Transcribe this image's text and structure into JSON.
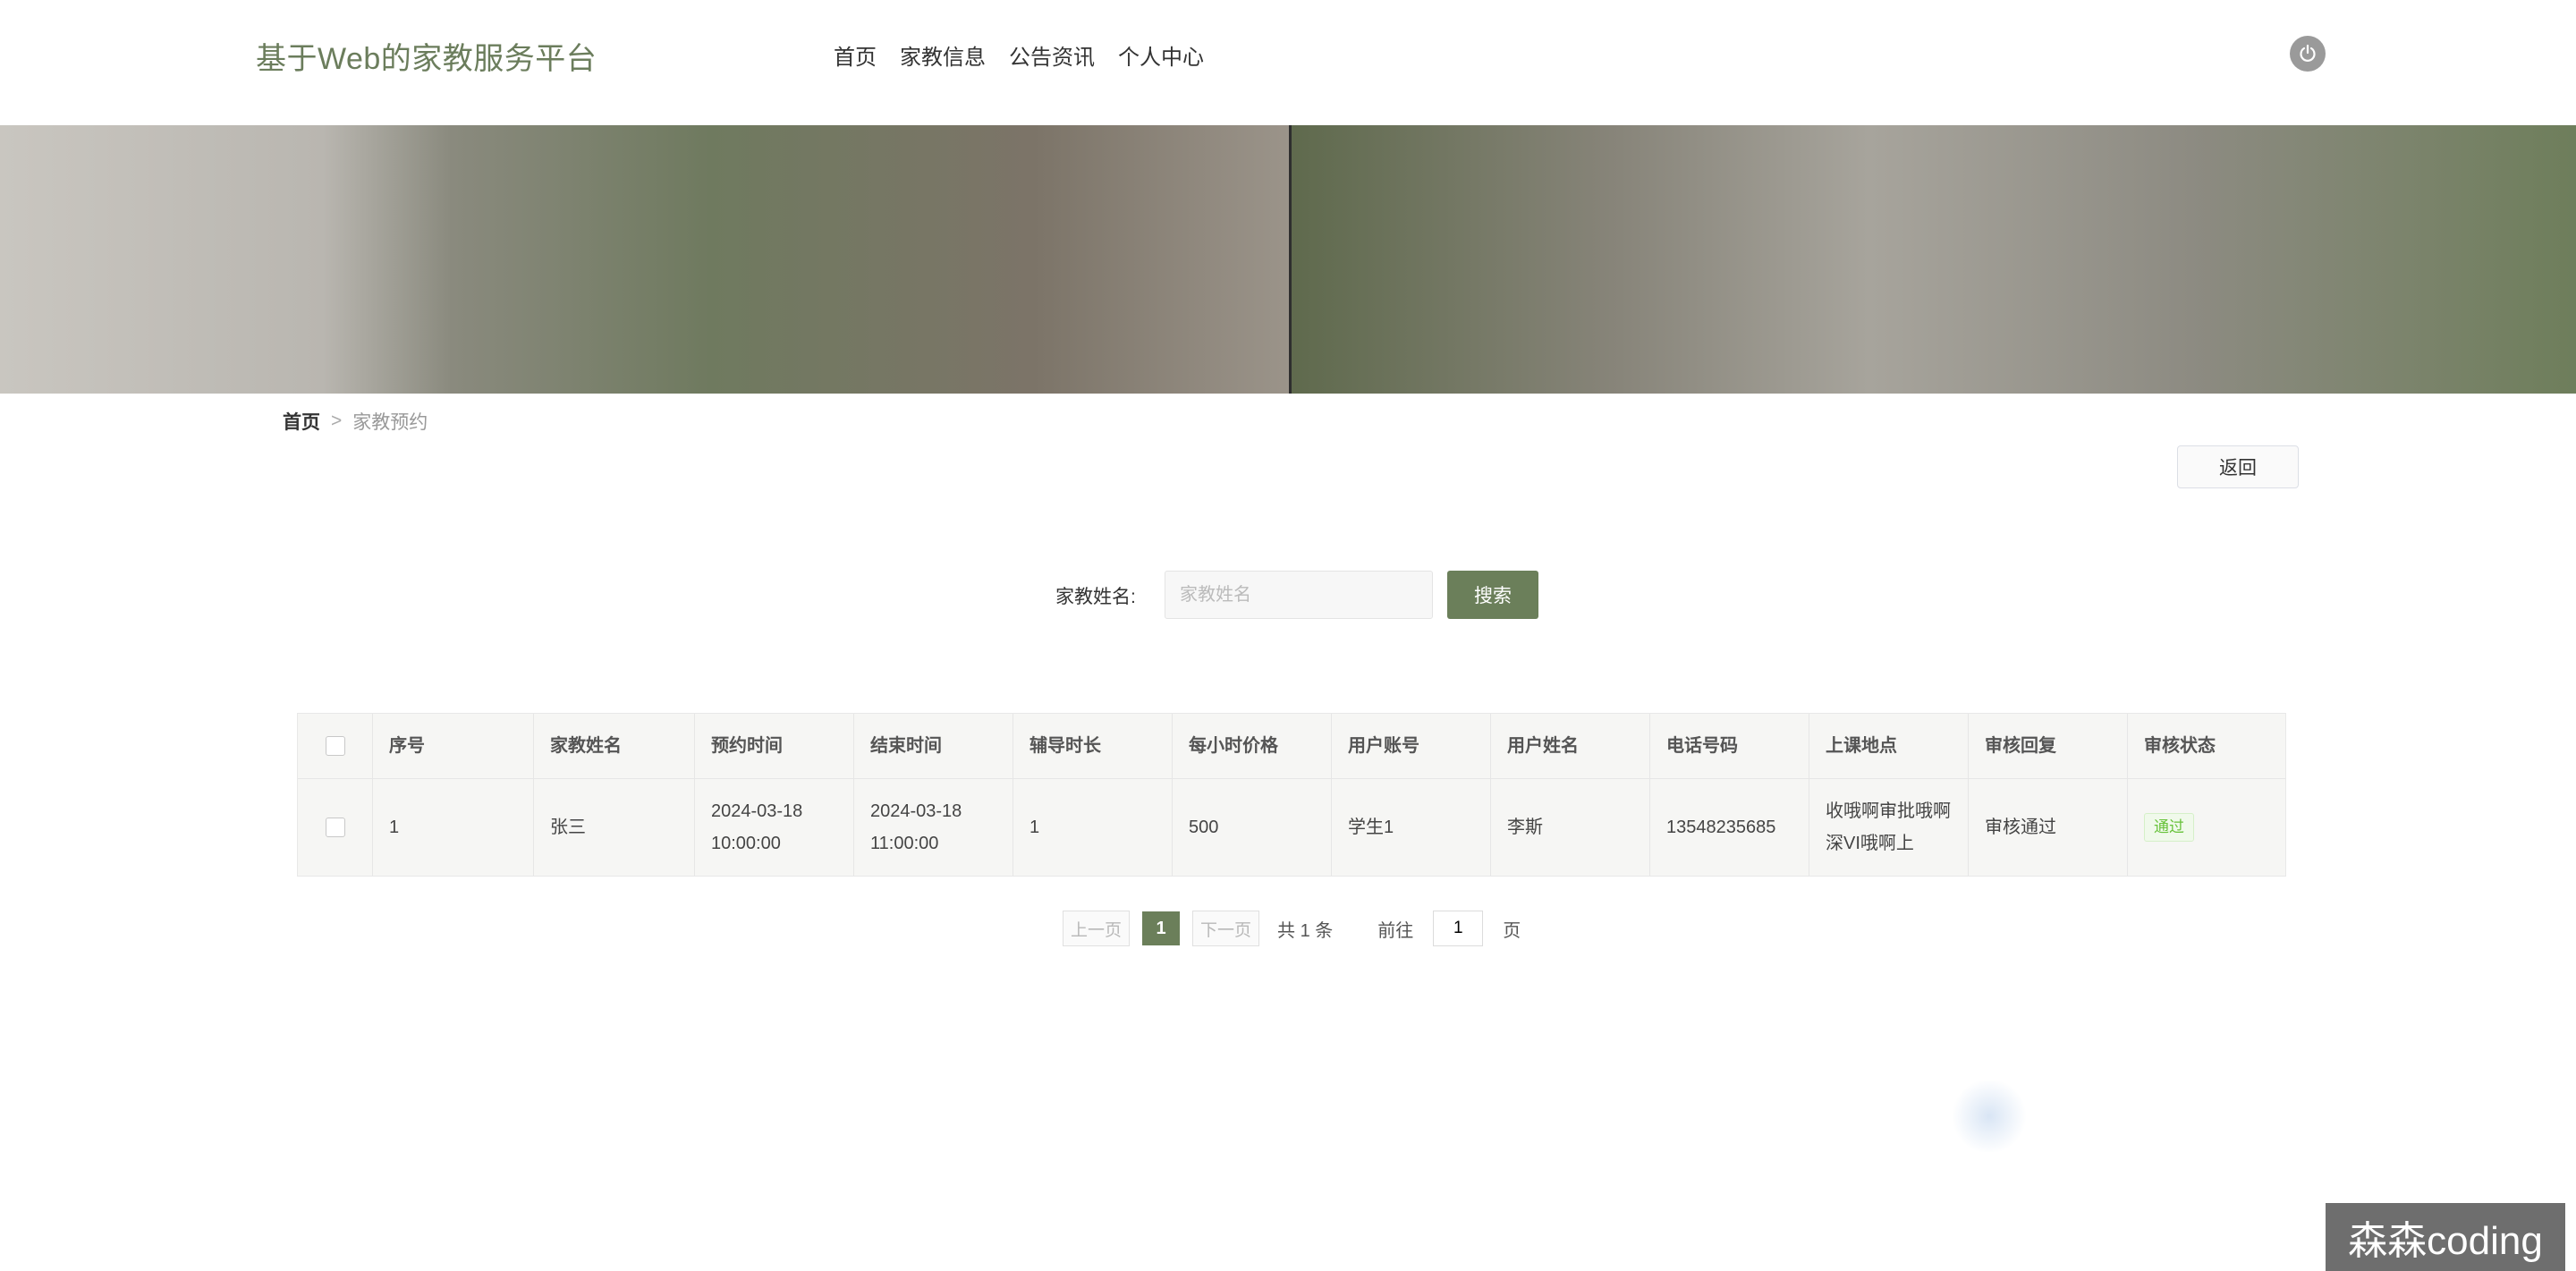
{
  "header": {
    "logo": "基于Web的家教服务平台",
    "nav": [
      "首页",
      "家教信息",
      "公告资讯",
      "个人中心"
    ],
    "power_icon": "power-icon"
  },
  "breadcrumb": {
    "home": "首页",
    "separator": ">",
    "current": "家教预约"
  },
  "back_label": "返回",
  "search": {
    "label": "家教姓名:",
    "placeholder": "家教姓名",
    "button": "搜索"
  },
  "table": {
    "headers": [
      "序号",
      "家教姓名",
      "预约时间",
      "结束时间",
      "辅导时长",
      "每小时价格",
      "用户账号",
      "用户姓名",
      "电话号码",
      "上课地点",
      "审核回复",
      "审核状态"
    ],
    "rows": [
      {
        "index": "1",
        "tutor_name": "张三",
        "start_time": "2024-03-18 10:00:00",
        "end_time": "2024-03-18 11:00:00",
        "duration": "1",
        "price": "500",
        "user_account": "学生1",
        "user_name": "李斯",
        "phone": "13548235685",
        "location": "收哦啊审批哦啊深VI哦啊上",
        "review_reply": "审核通过",
        "status": "通过"
      }
    ]
  },
  "pagination": {
    "prev": "上一页",
    "current": "1",
    "next": "下一页",
    "total": "共 1 条",
    "goto": "前往",
    "goto_value": "1",
    "page_suffix": "页"
  },
  "watermark": "森森coding",
  "colors": {
    "accent": "#6b7f5a",
    "status_green": "#67c23a"
  }
}
